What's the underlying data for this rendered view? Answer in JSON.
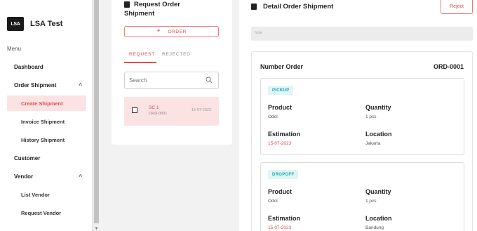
{
  "app": {
    "logo_text": "LSA",
    "name": "LSA Test"
  },
  "sidebar": {
    "menu_label": "Menu",
    "items": [
      {
        "label": "Dashboard"
      },
      {
        "label": "Order Shipment",
        "chevron": "^"
      },
      {
        "label": "Create Shipment",
        "active": true
      },
      {
        "label": "Invoice Shipment"
      },
      {
        "label": "History Shipment"
      },
      {
        "label": "Customer"
      },
      {
        "label": "Vendor",
        "chevron": "^"
      },
      {
        "label": "List Vendor"
      },
      {
        "label": "Request Vendor"
      }
    ]
  },
  "request_panel": {
    "title": "Request Order Shipment",
    "order_button": "ORDER",
    "tabs": [
      {
        "label": "REQUEST",
        "active": true
      },
      {
        "label": "REJECTED"
      }
    ],
    "search_placeholder": "Search",
    "list": [
      {
        "name": "SC 1",
        "order_id": "ORD-0001",
        "date": "15-07-2023"
      }
    ]
  },
  "detail_panel": {
    "title": "Detail Order Shipment",
    "reject_button": "Reject",
    "note_placeholder": "Note",
    "number_label": "Number Order",
    "number_value": "ORD-0001",
    "steps": [
      {
        "badge": "PICKUP",
        "product_label": "Product",
        "product_value": "Odol",
        "quantity_label": "Quantity",
        "quantity_value": "1 pcs",
        "estimation_label": "Estimation",
        "estimation_value": "15-07-2023",
        "location_label": "Location",
        "location_value": "Jakarta"
      },
      {
        "badge": "DROPOFF",
        "product_label": "Product",
        "product_value": "Odol",
        "quantity_label": "Quantity",
        "quantity_value": "1 pcs",
        "estimation_label": "Estimation",
        "estimation_value": "15-07-2023",
        "location_label": "Location",
        "location_value": "Bandung"
      }
    ]
  },
  "colors": {
    "accent": "#e24c4c",
    "accent_bg": "#fbe3e3",
    "badge_text": "#1aa6b4",
    "badge_bg": "#e0f5f6"
  }
}
